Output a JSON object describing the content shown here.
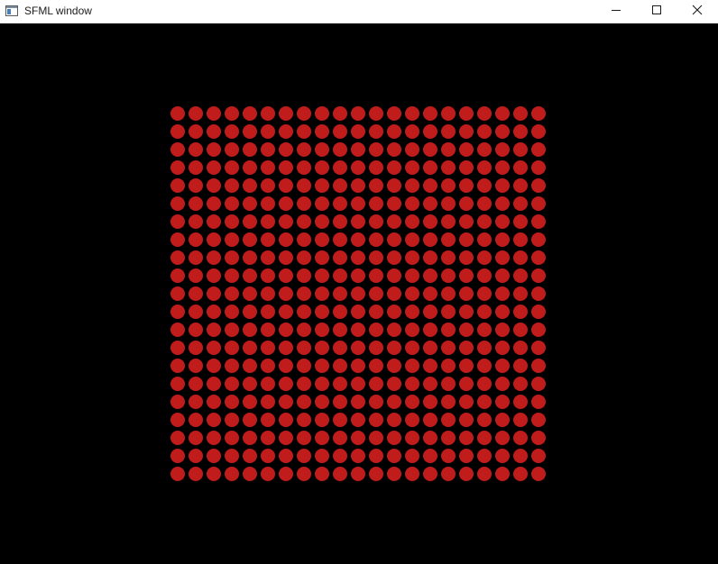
{
  "window": {
    "title": "SFML window",
    "app_icon": "sfml-window-icon",
    "controls": {
      "minimize_icon": "minimize-icon",
      "maximize_icon": "maximize-icon",
      "close_icon": "close-icon"
    }
  },
  "canvas": {
    "background_color": "#000000",
    "shape": "circle",
    "fill_color": "#c01c1c",
    "grid": {
      "rows": 21,
      "columns": 21
    }
  }
}
